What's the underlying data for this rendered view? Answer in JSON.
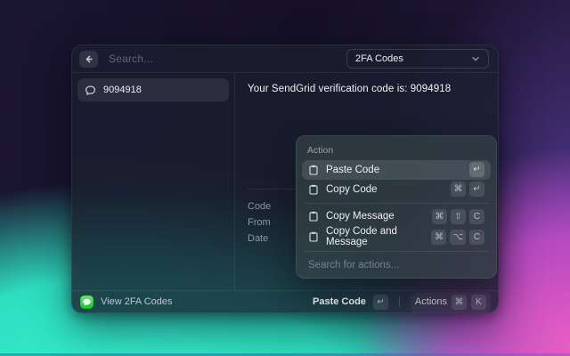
{
  "window": {
    "header": {
      "search_placeholder": "Search...",
      "dropdown_value": "2FA Codes"
    },
    "list": {
      "items": [
        {
          "label": "9094918"
        }
      ]
    },
    "detail": {
      "message": "Your SendGrid verification code is: 9094918",
      "meta_labels": [
        "Code",
        "From",
        "Date"
      ]
    },
    "action_panel": {
      "section_title": "Action",
      "actions": [
        {
          "label": "Paste Code",
          "keys": [
            "↵"
          ]
        },
        {
          "label": "Copy Code",
          "keys": [
            "⌘",
            "↵"
          ]
        },
        {
          "label": "Copy Message",
          "keys": [
            "⌘",
            "⇧",
            "C"
          ]
        },
        {
          "label": "Copy Code and Message",
          "keys": [
            "⌘",
            "⌥",
            "C"
          ]
        }
      ],
      "search_placeholder": "Search for actions..."
    },
    "status_bar": {
      "app_name": "View 2FA Codes",
      "primary_action": "Paste Code",
      "primary_key": "↵",
      "actions_label": "Actions",
      "actions_keys": [
        "⌘",
        "K"
      ]
    }
  },
  "colors": {
    "accent_teal": "#32e5c6",
    "accent_pink": "#ee60c8",
    "messages_green": "#27c93f"
  }
}
